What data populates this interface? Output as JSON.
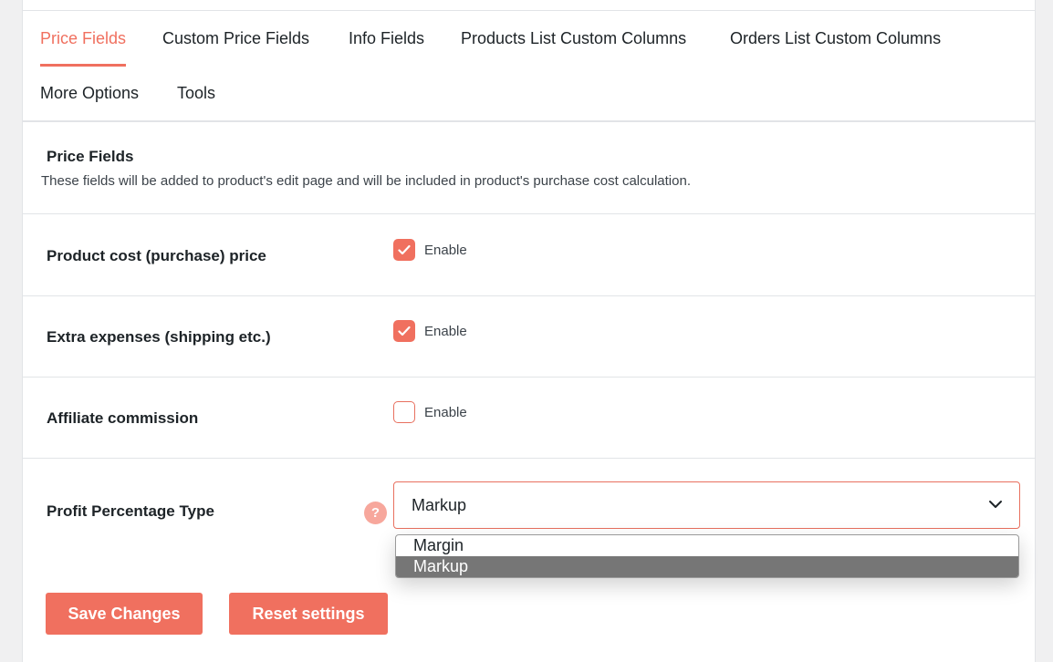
{
  "tabs": [
    {
      "label": "Price Fields",
      "active": true
    },
    {
      "label": "Custom Price Fields",
      "active": false
    },
    {
      "label": "Info Fields",
      "active": false
    },
    {
      "label": "Products List Custom Columns",
      "active": false
    },
    {
      "label": "Orders List Custom Columns",
      "active": false
    },
    {
      "label": "More Options",
      "active": false
    },
    {
      "label": "Tools",
      "active": false
    }
  ],
  "section": {
    "title": "Price Fields",
    "description": "These fields will be added to product's edit page and will be included in product's purchase cost calculation."
  },
  "fields": [
    {
      "label": "Product cost (purchase) price",
      "checkbox_label": "Enable",
      "checked": true
    },
    {
      "label": "Extra expenses (shipping etc.)",
      "checkbox_label": "Enable",
      "checked": true
    },
    {
      "label": "Affiliate commission",
      "checkbox_label": "Enable",
      "checked": false
    }
  ],
  "profit_type": {
    "label": "Profit Percentage Type",
    "help_glyph": "?",
    "selected": "Markup",
    "options": [
      "Margin",
      "Markup"
    ],
    "highlighted": "Markup"
  },
  "buttons": {
    "save": "Save Changes",
    "reset": "Reset settings"
  },
  "colors": {
    "accent": "#f0705f",
    "help_icon": "#f7a79c",
    "option_highlight": "#767676"
  }
}
